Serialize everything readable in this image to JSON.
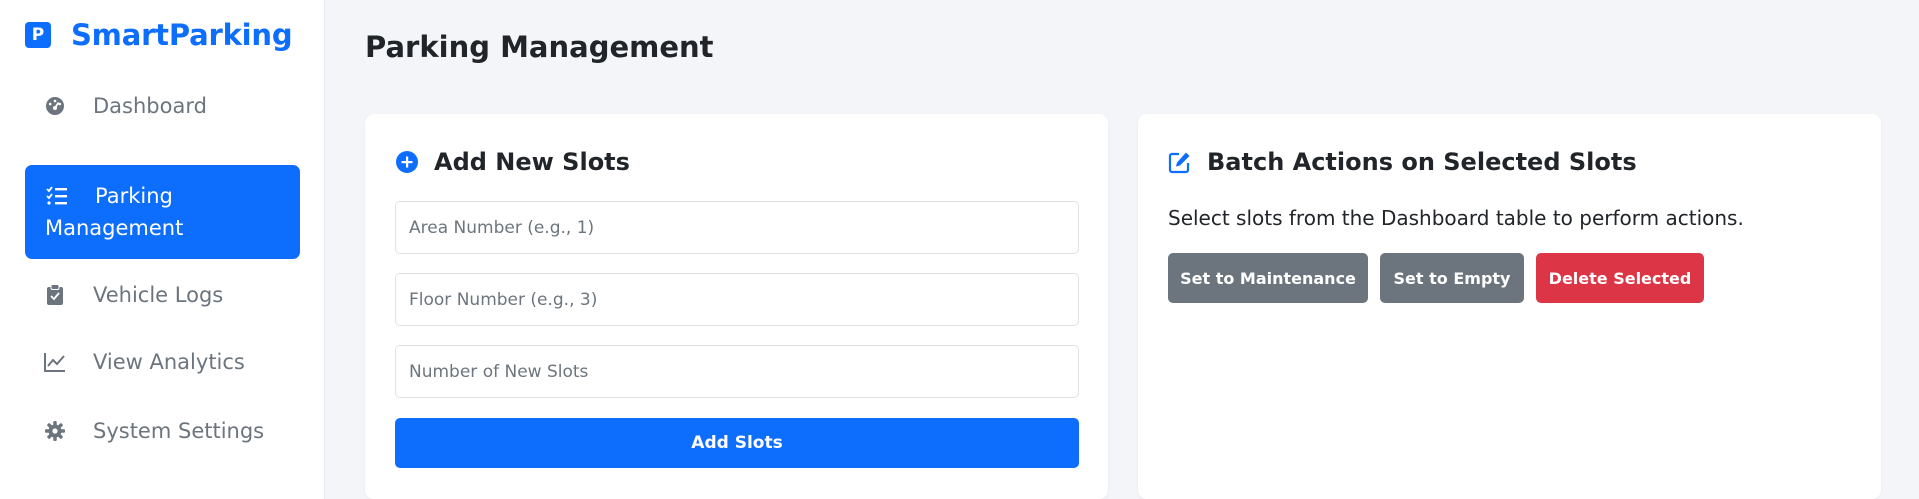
{
  "brand": {
    "logo_letter": "P",
    "name": "SmartParking",
    "color": "#0d6efd"
  },
  "sidebar": {
    "items": [
      {
        "label": "Dashboard",
        "icon": "gauge-icon",
        "active": false
      },
      {
        "label_line1": "Parking",
        "label_line2": "Management",
        "icon": "list-check-icon",
        "active": true
      },
      {
        "label": "Vehicle Logs",
        "icon": "clipboard-icon",
        "active": false
      },
      {
        "label": "View Analytics",
        "icon": "line-chart-icon",
        "active": false
      },
      {
        "label": "System Settings",
        "icon": "gear-icon",
        "active": false
      }
    ]
  },
  "main": {
    "title": "Parking Management",
    "add_card": {
      "title": "Add New Slots",
      "icon": "plus-circle-icon",
      "area_placeholder": "Area Number (e.g., 1)",
      "floor_placeholder": "Floor Number (e.g., 3)",
      "count_placeholder": "Number of New Slots",
      "submit_label": "Add Slots"
    },
    "batch_card": {
      "title": "Batch Actions on Selected Slots",
      "icon": "edit-icon",
      "helper": "Select slots from the Dashboard table to perform actions.",
      "maintenance_label": "Set to Maintenance",
      "empty_label": "Set to Empty",
      "delete_label": "Delete Selected"
    }
  },
  "colors": {
    "primary": "#0d6efd",
    "secondary": "#6c757d",
    "danger": "#dc3545",
    "background": "#f3f5f8"
  }
}
